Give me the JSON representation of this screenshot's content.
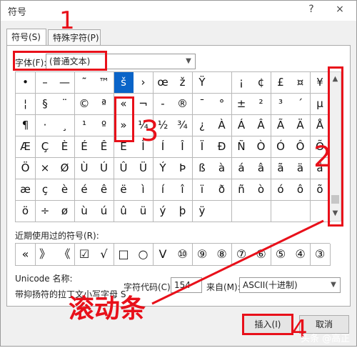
{
  "window": {
    "title": "符号",
    "help_label": "?",
    "close_label": "×"
  },
  "tabs": [
    {
      "label": "符号(S)"
    },
    {
      "label": "特殊字符(P)"
    }
  ],
  "font": {
    "label": "字体(F):",
    "value": "(普通文本)"
  },
  "symbol_grid": {
    "rows": [
      [
        "•",
        "–",
        "—",
        "˜",
        "™",
        "š",
        "›",
        "œ",
        "ž",
        "Ÿ",
        "",
        "¡",
        "¢",
        "£",
        "¤",
        "¥"
      ],
      [
        "¦",
        "§",
        "¨",
        "©",
        "ª",
        "«",
        "¬",
        "-",
        "®",
        "¯",
        "°",
        "±",
        "²",
        "³",
        "´",
        "µ"
      ],
      [
        "¶",
        "·",
        "¸",
        "¹",
        "º",
        "»",
        "¼",
        "½",
        "¾",
        "¿",
        "À",
        "Á",
        "Â",
        "Ã",
        "Ä",
        "Å"
      ],
      [
        "Æ",
        "Ç",
        "È",
        "É",
        "Ê",
        "Ë",
        "Ì",
        "Í",
        "Î",
        "Ï",
        "Ð",
        "Ñ",
        "Ò",
        "Ó",
        "Ô",
        "Õ"
      ],
      [
        "Ö",
        "×",
        "Ø",
        "Ù",
        "Ú",
        "Û",
        "Ü",
        "Ý",
        "Þ",
        "ß",
        "à",
        "á",
        "â",
        "ã",
        "ä",
        "å"
      ],
      [
        "æ",
        "ç",
        "è",
        "é",
        "ê",
        "ë",
        "ì",
        "í",
        "î",
        "ï",
        "ð",
        "ñ",
        "ò",
        "ó",
        "ô",
        "õ"
      ],
      [
        "ö",
        "÷",
        "ø",
        "ù",
        "ú",
        "û",
        "ü",
        "ý",
        "þ",
        "ÿ",
        "",
        "",
        "",
        "",
        "",
        ""
      ]
    ],
    "selected": "š"
  },
  "scrollbar": {
    "up_icon": "▲",
    "down_icon": "▼"
  },
  "recent": {
    "label": "近期使用过的符号(R):",
    "symbols": [
      "«",
      "》",
      "《",
      "☑",
      "√",
      "□",
      "○",
      "Ⅴ",
      "⑩",
      "⑨",
      "⑧",
      "⑦",
      "⑥",
      "⑤",
      "④",
      "③"
    ]
  },
  "unicode": {
    "name_label": "Unicode 名称:",
    "name_value": "带抑扬符的拉丁文小写字母 S"
  },
  "char_code": {
    "label": "字符代码(C):",
    "value": "154"
  },
  "from": {
    "label": "来自(M):",
    "value": "ASCII(十进制)"
  },
  "buttons": {
    "insert": "插入(I)",
    "cancel": "取消"
  },
  "annotations": {
    "n1": "1",
    "n2": "2",
    "n3": "3",
    "n4": "4",
    "scroll_text": "滚动条",
    "color": "#e8101a"
  },
  "watermark": "头条 @高正正"
}
